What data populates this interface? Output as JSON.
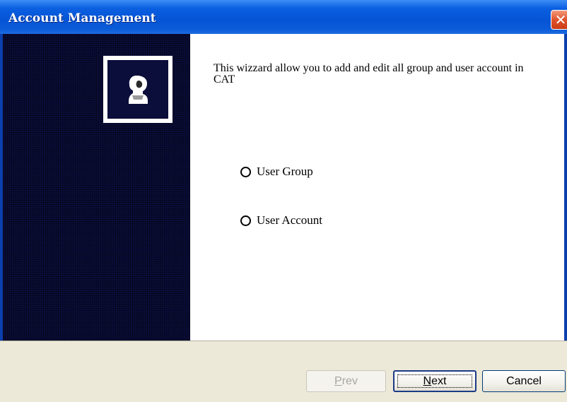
{
  "window": {
    "title": "Account Management",
    "close_glyph": "✕"
  },
  "content": {
    "intro_text": "This wizzard allow you to add and edit all group and user account in CAT",
    "options": [
      {
        "label": "User Group",
        "selected": false
      },
      {
        "label": "User Account",
        "selected": false
      }
    ]
  },
  "footer": {
    "prev": {
      "mnemonic": "P",
      "rest": "rev",
      "enabled": false
    },
    "next": {
      "mnemonic": "N",
      "rest": "ext",
      "enabled": true
    },
    "cancel_label": "Cancel"
  },
  "icons": {
    "sidebar_image": "user-account-silhouette-icon",
    "close": "close-icon"
  },
  "colors": {
    "titlebar": "#0654d6",
    "sidebar": "#0b0d3a",
    "close_button": "#e0532c",
    "dialog_footer": "#ece9d8"
  }
}
